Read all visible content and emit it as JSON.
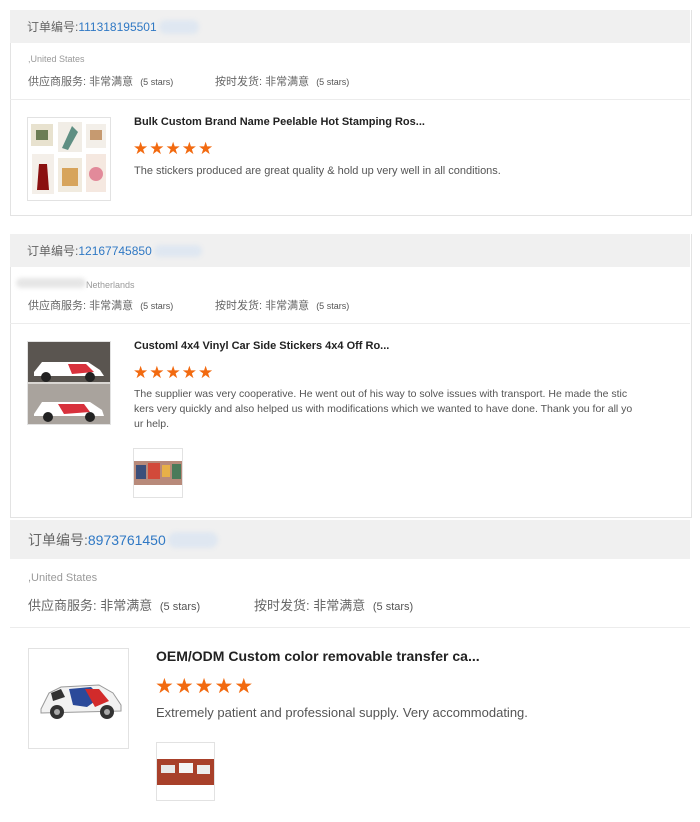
{
  "reviews": [
    {
      "order_label": "订单编号:",
      "order_number": "111318195501",
      "country": ",United States",
      "supplier_service_label": "供应商服务: 非常满意",
      "supplier_service_stars": "(5 stars)",
      "on_time_label": "按时发货: 非常满意",
      "on_time_stars": "(5 stars)",
      "product_title": "Bulk Custom Brand Name Peelable Hot Stamping Ros...",
      "rating": 5,
      "review_text": "The stickers produced are great quality & hold up very well in all conditions."
    },
    {
      "order_label": "订单编号:",
      "order_number": "12167745850",
      "country": "Netherlands",
      "supplier_service_label": "供应商服务: 非常满意",
      "supplier_service_stars": "(5 stars)",
      "on_time_label": "按时发货: 非常满意",
      "on_time_stars": "(5 stars)",
      "product_title": "Customl 4x4 Vinyl Car Side Stickers 4x4 Off Ro...",
      "rating": 5,
      "review_text_lines": [
        "The supplier was very cooperative. He went out of his way to solve issues with transport. He made the stic",
        "kers very quickly and also helped us with modifications which we wanted to have done. Thank you for all yo",
        "ur help."
      ]
    },
    {
      "order_label": "订单编号:",
      "order_number": "8973761450",
      "country": ",United States",
      "supplier_service_label": "供应商服务: 非常满意",
      "supplier_service_stars": "(5 stars)",
      "on_time_label": "按时发货: 非常满意",
      "on_time_stars": "(5 stars)",
      "product_title": "OEM/ODM Custom color removable transfer ca...",
      "rating": 5,
      "review_text": "Extremely patient and professional supply. Very accommodating."
    }
  ],
  "colors": {
    "accent_star": "#f26a10",
    "order_link": "#2f78c4",
    "bar_bg": "#f0f0f0"
  },
  "icons": {
    "star": "star-icon"
  }
}
